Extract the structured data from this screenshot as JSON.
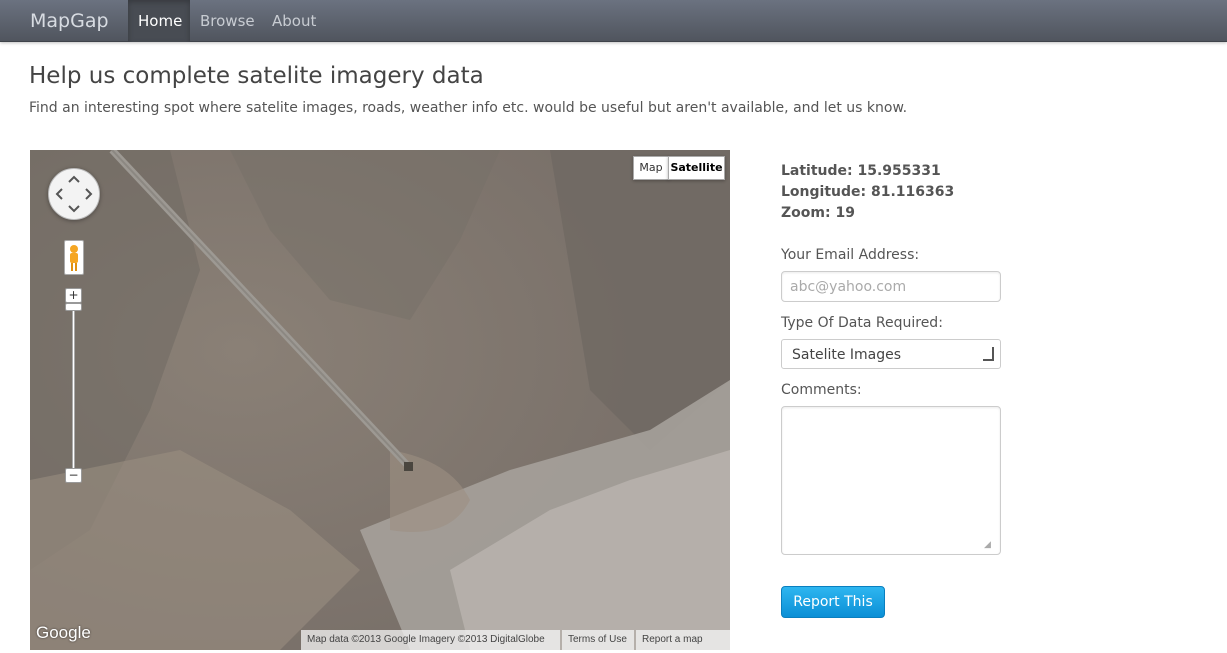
{
  "navbar": {
    "brand": "MapGap",
    "items": [
      {
        "label": "Home",
        "active": true
      },
      {
        "label": "Browse",
        "active": false
      },
      {
        "label": "About",
        "active": false
      }
    ]
  },
  "header": {
    "title": "Help us complete satelite imagery data",
    "subtitle": "Find an interesting spot where satelite images, roads, weather info etc. would be useful but aren't available, and let us know."
  },
  "map": {
    "type_buttons": {
      "map": "Map",
      "satellite": "Satellite"
    },
    "active_type": "Satellite",
    "zoom_in": "+",
    "zoom_out": "−",
    "logo": "Google",
    "attribution": "Map data ©2013 Google Imagery ©2013 DigitalGlobe",
    "terms": "Terms of Use",
    "report_error": "Report a map error"
  },
  "coordinates": {
    "latitude": "Latitude: 15.955331",
    "longitude": "Longitude: 81.116363",
    "zoom": "Zoom: 19"
  },
  "form": {
    "email_label": "Your Email Address:",
    "email_placeholder": "abc@yahoo.com",
    "type_label": "Type Of Data Required:",
    "type_selected": "Satelite Images",
    "comments_label": "Comments:",
    "submit_label": "Report This"
  },
  "colors": {
    "navbar": "#5c6169",
    "button": "#1ba4e6",
    "terrain": "#8d8378"
  }
}
